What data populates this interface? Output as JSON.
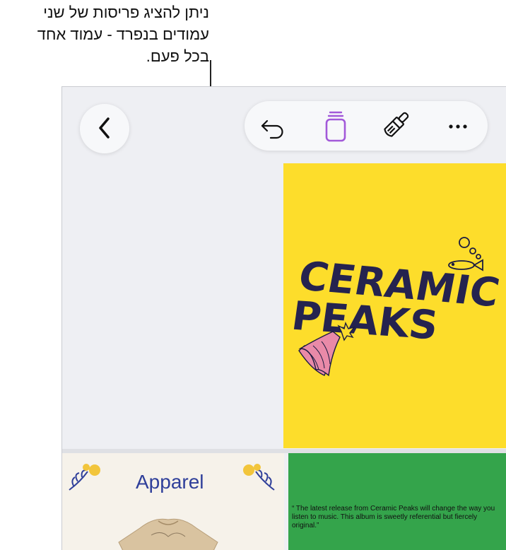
{
  "callout": {
    "line1": "ניתן להציג פריסות של שני",
    "line2": "עמודים בנפרד - עמוד אחד",
    "line3": "בכל פעם."
  },
  "toolbar": {
    "back_icon": "chevron-left-icon",
    "undo_icon": "undo-icon",
    "pages_icon": "page-stack-icon",
    "format_icon": "paintbrush-icon",
    "more_icon": "ellipsis-icon",
    "accent_color": "#a259d9"
  },
  "pages": {
    "poster": {
      "title_line1": "CERAMIC",
      "title_line2": "PEAKS",
      "background": "#fddd2b"
    },
    "apparel": {
      "title": "Apparel"
    },
    "review": {
      "text": "“ The latest release from Ceramic Peaks will change the way you listen to music. This album is sweetly referential but fiercely original.”"
    }
  }
}
